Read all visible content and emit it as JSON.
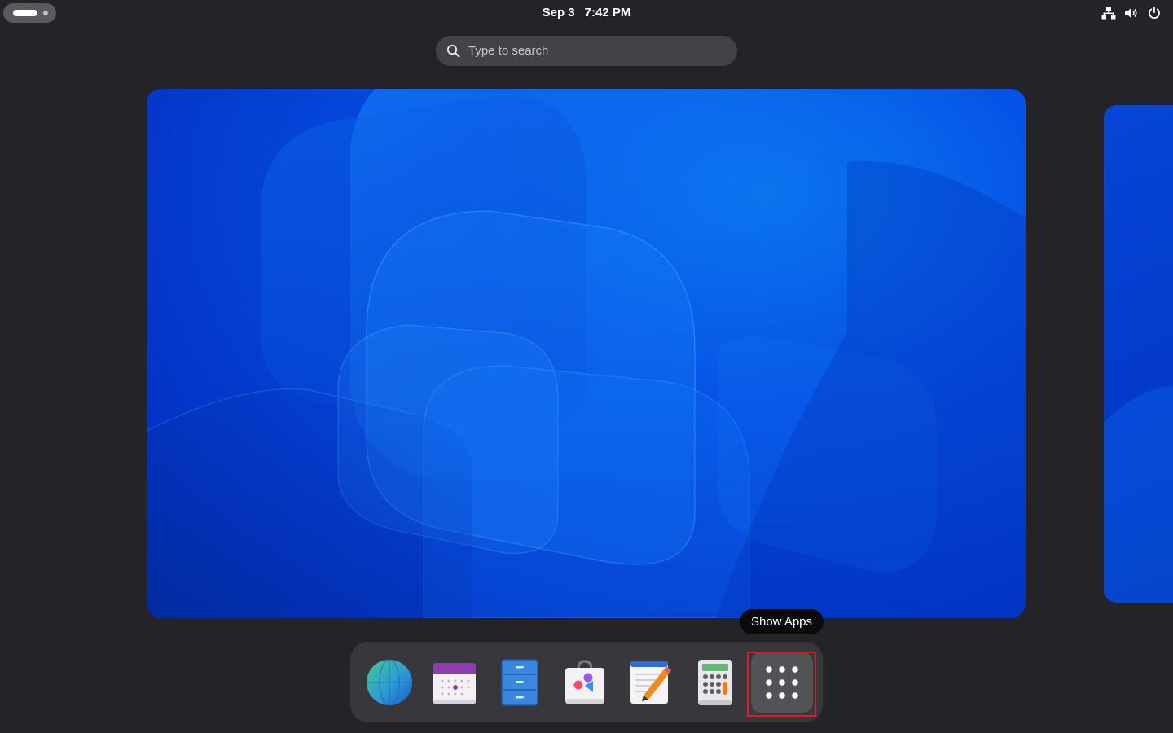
{
  "top_bar": {
    "date": "Sep 3",
    "time": "7:42 PM",
    "activities_icon": "workspace-indicator",
    "status_icons": [
      "network-wired-icon",
      "volume-icon",
      "power-icon"
    ]
  },
  "search": {
    "placeholder": "Type to search",
    "value": ""
  },
  "tooltip": {
    "text": "Show Apps"
  },
  "dock": {
    "items": [
      {
        "name": "web-browser",
        "icon": "globe-icon"
      },
      {
        "name": "calendar",
        "icon": "calendar-icon"
      },
      {
        "name": "files",
        "icon": "file-cabinet-icon"
      },
      {
        "name": "software",
        "icon": "shopping-bag-icon"
      },
      {
        "name": "text-editor",
        "icon": "notepad-pencil-icon"
      },
      {
        "name": "calculator",
        "icon": "calculator-icon"
      },
      {
        "name": "show-apps",
        "icon": "app-grid-icon"
      }
    ]
  },
  "colors": {
    "background": "#242428",
    "wallpaper_blue": "#0650e6",
    "highlight_border": "#e01b24"
  }
}
